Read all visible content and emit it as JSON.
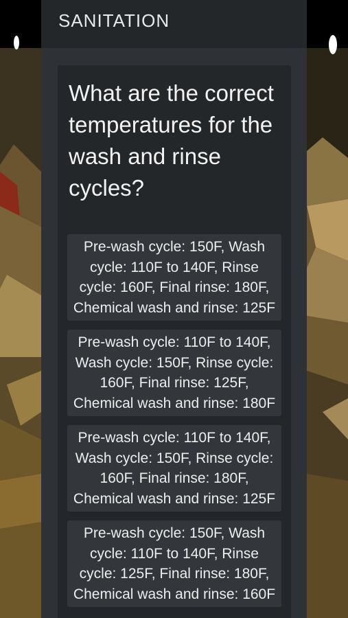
{
  "header": {
    "title": "SANITATION"
  },
  "question": {
    "text": "What are the correct temperatures for the wash and rinse cycles?"
  },
  "answers": [
    {
      "label": "Pre-wash cycle: 150F, Wash cycle: 110F to 140F, Rinse cycle: 160F, Final rinse: 180F, Chemical wash and rinse: 125F"
    },
    {
      "label": "Pre-wash cycle: 110F to 140F, Wash cycle: 150F, Rinse cycle: 160F, Final rinse: 125F, Chemical wash and rinse: 180F"
    },
    {
      "label": "Pre-wash cycle: 110F to 140F, Wash cycle: 150F, Rinse cycle: 160F, Final rinse: 180F, Chemical wash and rinse: 125F"
    },
    {
      "label": "Pre-wash cycle: 150F, Wash cycle: 110F to 140F, Rinse cycle: 125F, Final rinse: 180F, Chemical wash and rinse: 160F"
    }
  ]
}
